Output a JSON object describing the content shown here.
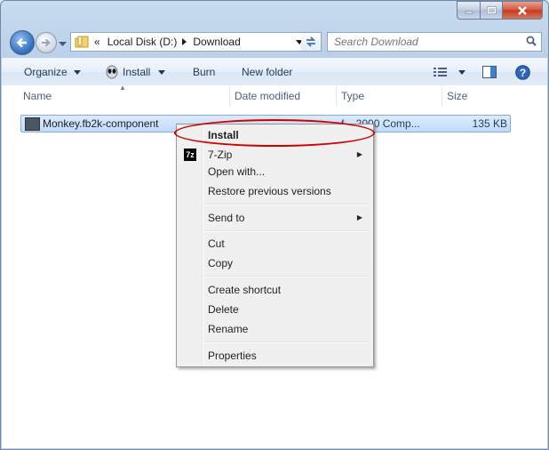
{
  "window": {
    "controls": [
      "minimize",
      "maximize",
      "close"
    ]
  },
  "navigation": {
    "path_overflow": "«",
    "path": [
      "Local Disk (D:)",
      "Download"
    ],
    "search_placeholder": "Search Download"
  },
  "toolbar": {
    "organize": "Organize",
    "install": "Install",
    "burn": "Burn",
    "new_folder": "New folder"
  },
  "columns": [
    "Name",
    "Date modified",
    "Type",
    "Size"
  ],
  "files": [
    {
      "name": "Monkey.fb2k-component",
      "type_fragment": "f... 2000 Comp...",
      "size": "135 KB"
    }
  ],
  "context_menu": {
    "items": [
      {
        "label": "Install",
        "bold": true
      },
      {
        "label": "7-Zip",
        "submenu": true,
        "icon": "7z"
      },
      {
        "label": "Open with..."
      },
      {
        "label": "Restore previous versions"
      },
      {
        "label": "Send to",
        "submenu": true
      },
      {
        "label": "Cut"
      },
      {
        "label": "Copy"
      },
      {
        "label": "Create shortcut"
      },
      {
        "label": "Delete"
      },
      {
        "label": "Rename"
      },
      {
        "label": "Properties"
      }
    ]
  },
  "annotation": {
    "highlight_color": "#d10000",
    "highlighted_item": "Install"
  }
}
